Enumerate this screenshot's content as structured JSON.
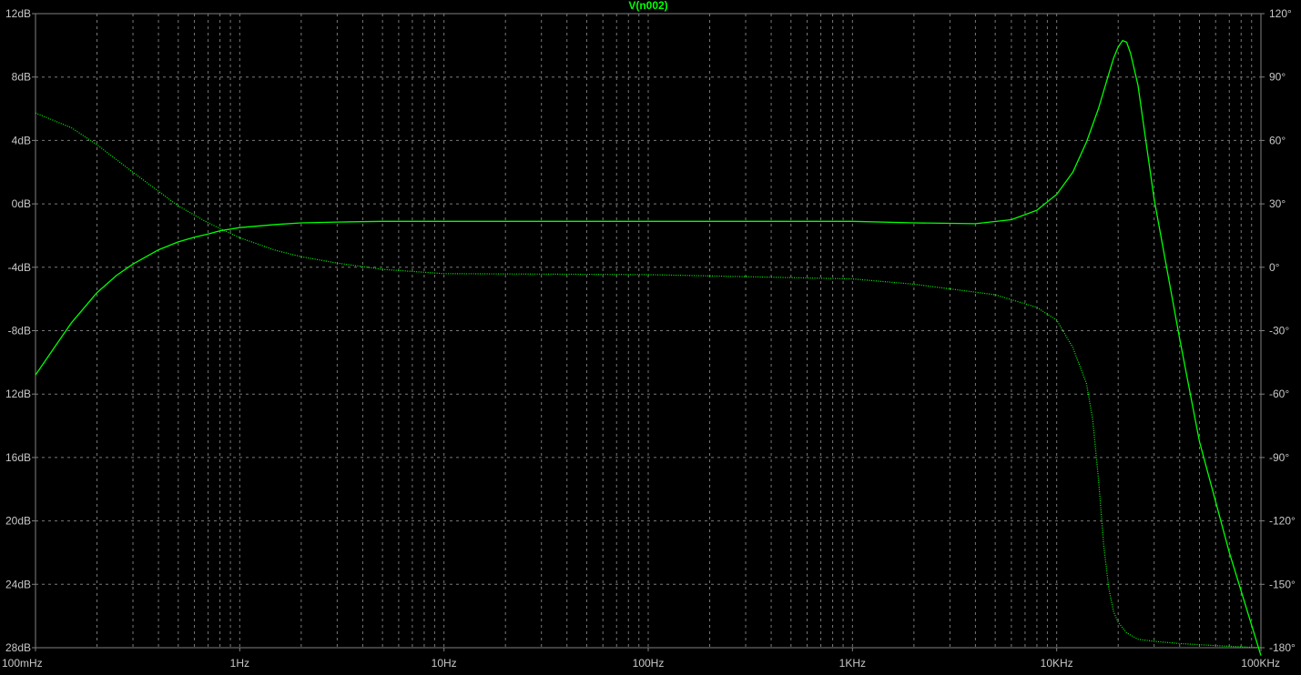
{
  "chart_data": {
    "type": "line",
    "title": "V(n002)",
    "x_scale": "log",
    "xlim": [
      0.1,
      100000
    ],
    "x_tick_labels": [
      "100mHz",
      "1Hz",
      "10Hz",
      "100Hz",
      "1KHz",
      "10KHz",
      "100KHz"
    ],
    "x_tick_values": [
      0.1,
      1,
      10,
      100,
      1000,
      10000,
      100000
    ],
    "ylim_left": [
      -28,
      12
    ],
    "y_left_tick_values": [
      12,
      8,
      4,
      0,
      -4,
      -8,
      -12,
      -16,
      -20,
      -24,
      -28
    ],
    "y_left_tick_labels": [
      "12dB",
      "8dB",
      "4dB",
      "0dB",
      "-4dB",
      "-8dB",
      "12dB",
      "16dB",
      "20dB",
      "24dB",
      "28dB"
    ],
    "ylim_right": [
      -180,
      120
    ],
    "y_right_tick_values": [
      120,
      90,
      60,
      30,
      0,
      -30,
      -60,
      -90,
      -120,
      -150,
      -180
    ],
    "y_right_tick_labels": [
      "120°",
      "90°",
      "60°",
      "30°",
      "0°",
      "-30°",
      "-60°",
      "-90°",
      "-120°",
      "-150°",
      "-180°"
    ],
    "grid": true,
    "colors": {
      "background": "#000000",
      "axis": "#808080",
      "grid": "#7a7a7a",
      "tick_label": "#c8c8c8",
      "title": "#00ff00",
      "magnitude": "#00ff00",
      "phase": "#00ff00"
    },
    "series": [
      {
        "axis": "left",
        "style": "solid",
        "x": [
          0.1,
          0.12,
          0.15,
          0.2,
          0.25,
          0.3,
          0.4,
          0.5,
          0.6,
          0.7,
          0.8,
          1,
          1.5,
          2,
          3,
          5,
          10,
          100,
          1000,
          2000,
          4000,
          6000,
          8000,
          10000,
          12000,
          14000,
          16000,
          18000,
          19000,
          20000,
          21000,
          22000,
          23000,
          25000,
          28000,
          30000,
          40000,
          50000,
          70000,
          100000
        ],
        "values": [
          -10.8,
          -9.3,
          -7.5,
          -5.6,
          -4.5,
          -3.8,
          -2.9,
          -2.4,
          -2.1,
          -1.9,
          -1.7,
          -1.5,
          -1.3,
          -1.2,
          -1.15,
          -1.1,
          -1.1,
          -1.1,
          -1.1,
          -1.2,
          -1.25,
          -1.0,
          -0.4,
          0.6,
          2.0,
          3.9,
          6.0,
          8.2,
          9.2,
          9.9,
          10.3,
          10.2,
          9.5,
          7.5,
          3.0,
          0.3,
          -8.5,
          -15.0,
          -22.0,
          -28.5
        ]
      },
      {
        "axis": "right",
        "style": "dotted",
        "x": [
          0.1,
          0.15,
          0.2,
          0.3,
          0.4,
          0.5,
          0.7,
          1,
          1.5,
          2,
          3,
          5,
          10,
          100,
          1000,
          2000,
          5000,
          8000,
          10000,
          12000,
          14000,
          15000,
          16000,
          17000,
          18000,
          19000,
          20000,
          22000,
          25000,
          30000,
          40000,
          60000,
          100000
        ],
        "values": [
          73,
          66,
          58,
          45,
          36,
          29,
          21,
          14,
          8,
          5,
          2,
          -1,
          -3,
          -3.5,
          -5.5,
          -8,
          -13,
          -19,
          -25,
          -38,
          -55,
          -72,
          -100,
          -132,
          -152,
          -163,
          -168,
          -173,
          -176,
          -177,
          -178,
          -179,
          -180
        ]
      }
    ]
  }
}
